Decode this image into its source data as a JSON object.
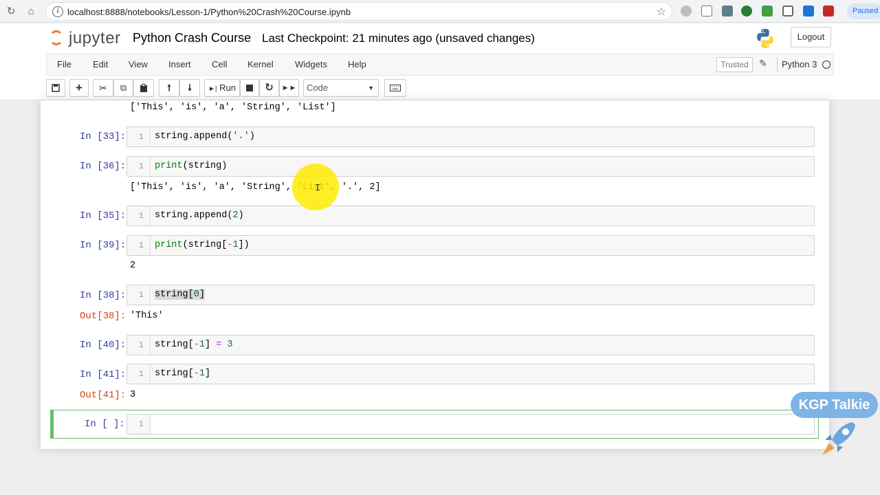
{
  "browser": {
    "url": "localhost:8888/notebooks/Lesson-1/Python%20Crash%20Course.ipynb",
    "paused_label": "Paused"
  },
  "header": {
    "logo_text": "jupyter",
    "notebook_name": "Python Crash Course",
    "checkpoint": "Last Checkpoint: 21 minutes ago  (unsaved changes)",
    "logout_label": "Logout"
  },
  "menu": {
    "items": [
      "File",
      "Edit",
      "View",
      "Insert",
      "Cell",
      "Kernel",
      "Widgets",
      "Help"
    ],
    "trusted_label": "Trusted",
    "kernel_name": "Python 3"
  },
  "toolbar": {
    "run_label": "Run",
    "cell_type": "Code"
  },
  "cells": {
    "top_output": "['This', 'is', 'a', 'String', 'List']",
    "c33": {
      "prompt": "In [33]:",
      "line": "1"
    },
    "c36": {
      "prompt": "In [36]:",
      "line": "1",
      "output": "['This', 'is', 'a', 'String', 'List', '.', 2]"
    },
    "c35": {
      "prompt": "In [35]:",
      "line": "1"
    },
    "c39": {
      "prompt": "In [39]:",
      "line": "1",
      "output": "2"
    },
    "c38": {
      "prompt": "In [38]:",
      "line": "1",
      "out_prompt": "Out[38]:",
      "output": "'This'"
    },
    "c40": {
      "prompt": "In [40]:",
      "line": "1"
    },
    "c41": {
      "prompt": "In [41]:",
      "line": "1",
      "out_prompt": "Out[41]:",
      "output": "3"
    },
    "new": {
      "prompt": "In [ ]:",
      "line": "1"
    }
  },
  "code": {
    "c33": {
      "a": "string.append(",
      "b": "'.'",
      "c": ")"
    },
    "c36": {
      "a": "print",
      "b": "(string)"
    },
    "c35": {
      "a": "string.append(",
      "b": "2",
      "c": ")"
    },
    "c39": {
      "a": "print",
      "b": "(string[",
      "c": "-",
      "d": "1",
      "e": "])"
    },
    "c38": {
      "a": "string[",
      "b": "0",
      "c": "]"
    },
    "c40": {
      "a": "string[",
      "b": "-",
      "c": "1",
      "d": "] ",
      "e": "=",
      "f": " ",
      "g": "3"
    },
    "c41": {
      "a": "string[",
      "b": "-",
      "c": "1",
      "d": "]"
    }
  },
  "watermark": {
    "text": "KGP Talkie"
  },
  "colors": {
    "in_prompt": "#303f9f",
    "out_prompt": "#d84315",
    "selected_border": "#66bb6a",
    "jupyter_orange": "#f37726"
  }
}
